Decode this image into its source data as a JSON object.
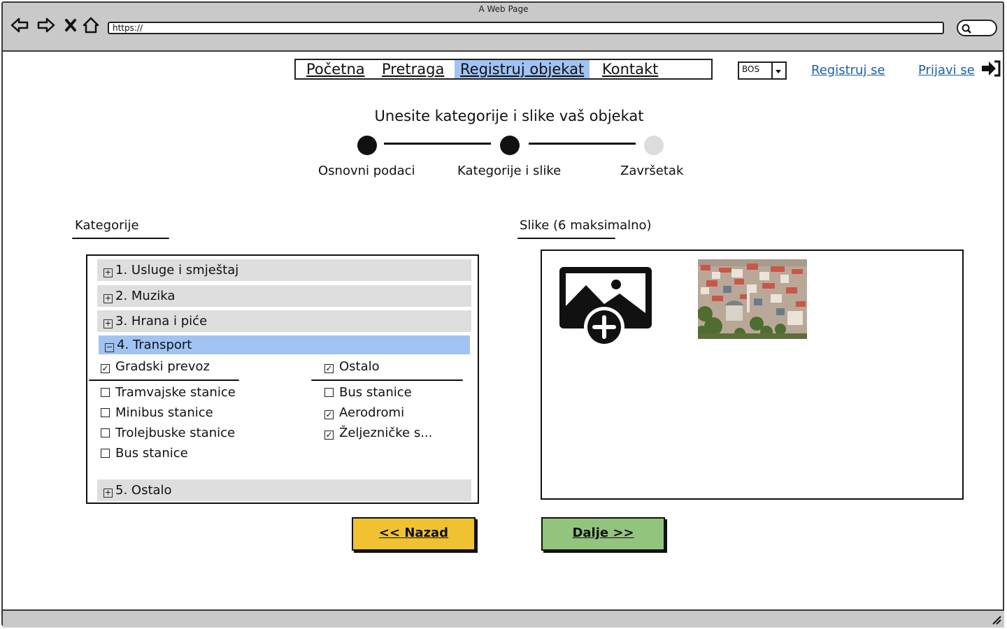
{
  "browser": {
    "window_title": "A Web Page",
    "url": "https://"
  },
  "nav": {
    "items": [
      {
        "label": "Početna",
        "active": false
      },
      {
        "label": "Pretraga",
        "active": false
      },
      {
        "label": "Registruj objekat",
        "active": true
      },
      {
        "label": "Kontakt",
        "active": false
      }
    ],
    "language": "BOS",
    "register_link": "Registruj se",
    "login_link": "Prijavi se"
  },
  "wizard": {
    "title": "Unesite kategorije i slike vaš objekat",
    "steps": [
      {
        "label": "Osnovni podaci",
        "state": "done"
      },
      {
        "label": "Kategorije i slike",
        "state": "current"
      },
      {
        "label": "Završetak",
        "state": "pending"
      }
    ]
  },
  "categories": {
    "heading": "Kategorije",
    "groups": [
      {
        "label": "1. Usluge i smještaj",
        "expanded": false
      },
      {
        "label": "2. Muzika",
        "expanded": false
      },
      {
        "label": "3. Hrana i piće",
        "expanded": false
      },
      {
        "label": "4. Transport",
        "expanded": true
      },
      {
        "label": "5. Ostalo",
        "expanded": false
      }
    ],
    "transport": {
      "left_group": {
        "label": "Gradski prevoz",
        "checked": true,
        "items": [
          {
            "label": "Tramvajske stanice",
            "checked": false
          },
          {
            "label": "Minibus stanice",
            "checked": false
          },
          {
            "label": "Trolejbuske stanice",
            "checked": false
          },
          {
            "label": "Bus stanice",
            "checked": false
          }
        ]
      },
      "right_group": {
        "label": "Ostalo",
        "checked": true,
        "items": [
          {
            "label": "Bus stanice",
            "checked": false
          },
          {
            "label": "Aerodromi",
            "checked": true
          },
          {
            "label": "Željezničke s...",
            "checked": true
          }
        ]
      }
    }
  },
  "images": {
    "heading": "Slike (6 maksimalno)",
    "add_icon": "add-image-icon",
    "thumbnail": "city-photo"
  },
  "buttons": {
    "back": "<< Nazad",
    "next": "Dalje >>"
  },
  "colors": {
    "accent": "#a1c3f4",
    "back_button": "#f0c232",
    "next_button": "#93c47d",
    "link": "#1c5fa8"
  }
}
